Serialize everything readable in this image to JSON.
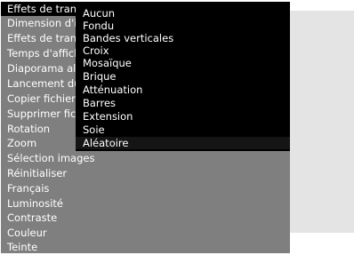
{
  "menu": {
    "items": [
      {
        "label": "Effets de transition"
      },
      {
        "label": "Dimension d'image"
      },
      {
        "label": "Effets de transition"
      },
      {
        "label": "Temps d'affichage"
      },
      {
        "label": "Diaporama aléatoire"
      },
      {
        "label": "Lancement du diaporama"
      },
      {
        "label": "Copier fichier"
      },
      {
        "label": "Supprimer fichier"
      },
      {
        "label": "Rotation"
      },
      {
        "label": "Zoom"
      },
      {
        "label": "Sélection images"
      },
      {
        "label": "Réinitialiser"
      },
      {
        "label": "Français"
      },
      {
        "label": "Luminosité"
      },
      {
        "label": "Contraste"
      },
      {
        "label": "Couleur"
      },
      {
        "label": "Teinte"
      }
    ]
  },
  "submenu": {
    "items": [
      {
        "label": "Aucun"
      },
      {
        "label": "Fondu"
      },
      {
        "label": "Bandes verticales"
      },
      {
        "label": "Croix"
      },
      {
        "label": "Mosaïque"
      },
      {
        "label": "Brique"
      },
      {
        "label": "Atténuation"
      },
      {
        "label": "Barres"
      },
      {
        "label": "Extension"
      },
      {
        "label": "Soie"
      },
      {
        "label": "Aléatoire"
      }
    ],
    "selected_index": 10
  },
  "colors": {
    "menu_bg": "#7f7f7f",
    "submenu_bg": "#000000",
    "panel_bg": "#e4e4e4",
    "text": "#ffffff"
  }
}
